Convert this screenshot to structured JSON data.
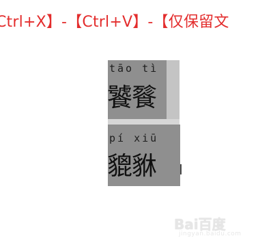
{
  "instruction": "Ctrl+X】-【Ctrl+V】-【仅保留文",
  "blocks": [
    {
      "pinyin": "tāo tì",
      "hanzi": "饕餮"
    },
    {
      "pinyin": "pí xiū",
      "hanzi": "貔貅"
    }
  ],
  "cursor_icon": "text-cursor-icon",
  "watermark": {
    "logo": "Bai百度",
    "sub": "jingyan.baidu.com"
  },
  "colors": {
    "instruction": "#e32d2d",
    "selection": "#8f8f8f",
    "selection_edge": "#c4c4c4"
  }
}
